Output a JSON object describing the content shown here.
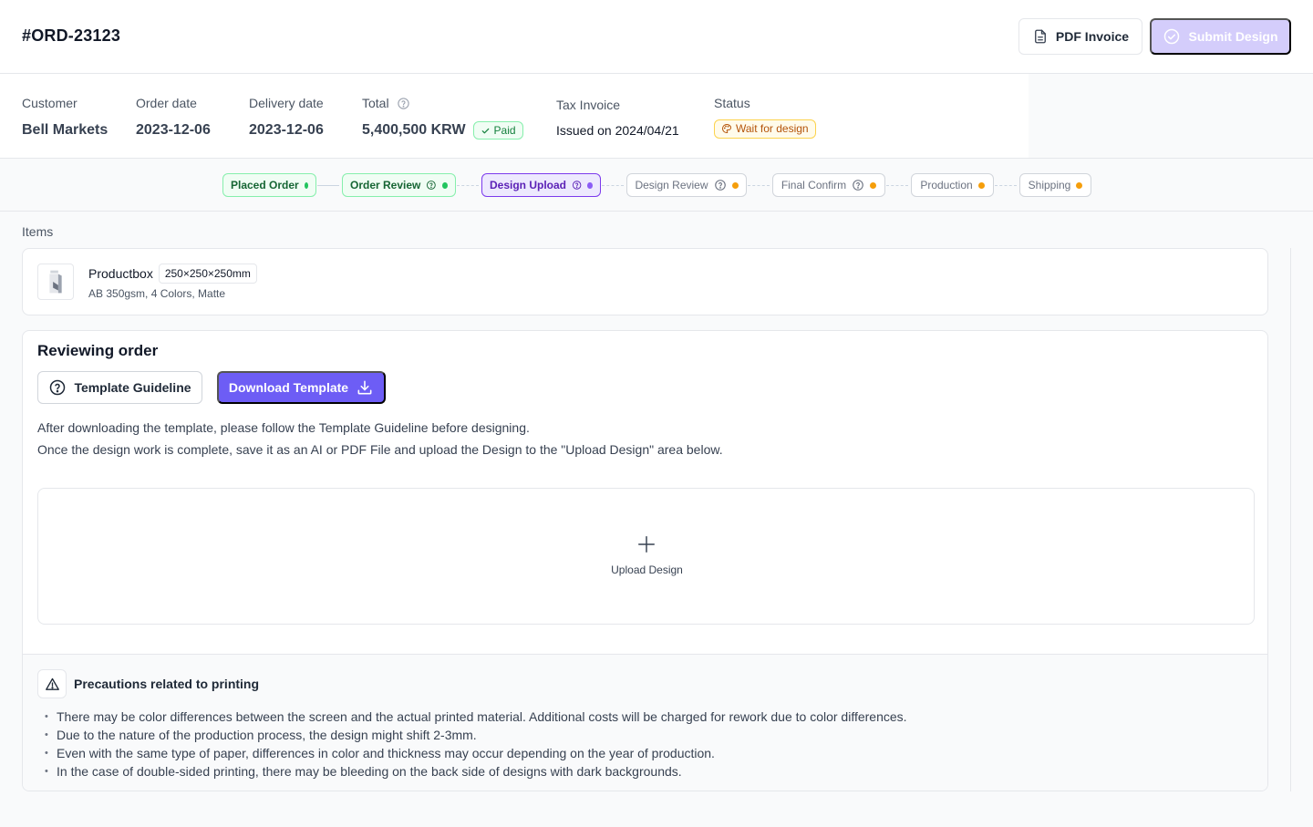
{
  "header": {
    "order_id": "#ORD-23123",
    "pdf_invoice_label": "PDF Invoice",
    "submit_design_label": "Submit Design"
  },
  "summary": {
    "customer": {
      "label": "Customer",
      "value": "Bell Markets"
    },
    "order_date": {
      "label": "Order date",
      "value": "2023-12-06"
    },
    "delivery_date": {
      "label": "Delivery date",
      "value": "2023-12-06"
    },
    "total": {
      "label": "Total",
      "value": "5,400,500 KRW",
      "badge": "Paid"
    },
    "tax_invoice": {
      "label": "Tax Invoice",
      "value": "Issued on 2024/04/21"
    },
    "status": {
      "label": "Status",
      "value": "Wait for design"
    }
  },
  "steps": [
    {
      "label": "Placed Order",
      "state": "done"
    },
    {
      "label": "Order Review",
      "state": "done"
    },
    {
      "label": "Design Upload",
      "state": "active"
    },
    {
      "label": "Design Review",
      "state": "pending"
    },
    {
      "label": "Final Confirm",
      "state": "pending"
    },
    {
      "label": "Production",
      "state": "pending"
    },
    {
      "label": "Shipping",
      "state": "pending"
    }
  ],
  "items": {
    "label": "Items",
    "list": [
      {
        "name": "Productbox",
        "dimensions": "250×250×250mm",
        "spec": "AB 350gsm, 4 Colors, Matte"
      }
    ]
  },
  "review": {
    "title": "Reviewing order",
    "guideline_label": "Template Guideline",
    "download_label": "Download Template",
    "desc1": "After downloading the template, please follow the Template Guideline before designing.",
    "desc2": "Once the design work is complete, save it as an AI or PDF File and upload the Design to the \"Upload Design\" area below.",
    "upload_label": "Upload Design"
  },
  "precautions": {
    "title": "Precautions related to printing",
    "items": [
      "There may be color differences between the screen and the actual printed material. Additional costs will be charged for rework due to color differences.",
      "Due to the nature of the production process, the design might shift 2-3mm.",
      "Even with the same type of paper, differences in color and thickness may occur depending on the year of production.",
      "In the case of double-sided printing, there may be bleeding on the back side of designs with dark backgrounds."
    ]
  },
  "colors": {
    "primary": "#6d5df5",
    "primary_disabled": "#d4cdfb",
    "success": "#22c55e",
    "warning": "#f59e0b",
    "active_step": "#8b5cf6"
  },
  "icons": {
    "pdf": "document-icon",
    "submit": "check-circle-icon",
    "help": "question-circle-icon",
    "download": "download-icon",
    "upload": "plus-icon",
    "warning": "warning-triangle-icon"
  }
}
